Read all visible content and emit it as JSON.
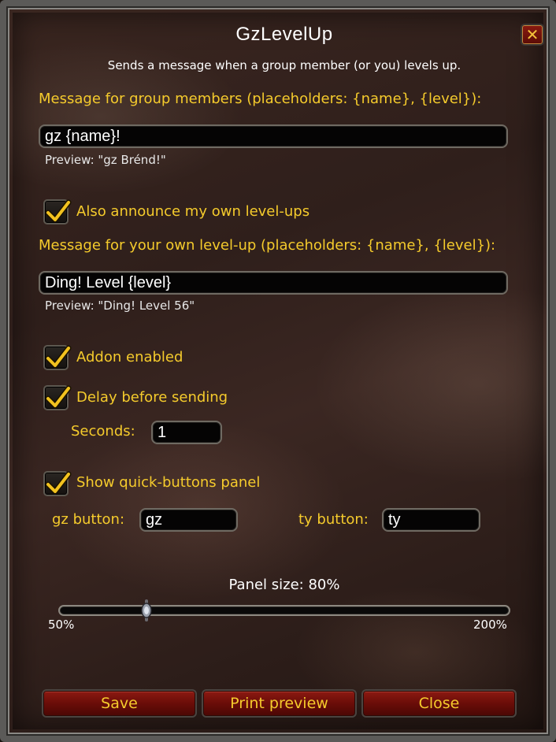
{
  "window": {
    "title": "GzLevelUp",
    "subtitle": "Sends a message when a group member (or you) levels up.",
    "close_symbol": "✕"
  },
  "group_message": {
    "label": "Message for group members (placeholders: {name}, {level}):",
    "value": "gz {name}!",
    "preview": "Preview: \"gz Brénd!\""
  },
  "own_announce": {
    "label": "Also announce my own level-ups",
    "checked": true
  },
  "own_message": {
    "label": "Message for your own level-up (placeholders: {name}, {level}):",
    "value": "Ding! Level {level}",
    "preview": "Preview: \"Ding! Level 56\""
  },
  "addon_enabled": {
    "label": "Addon enabled",
    "checked": true
  },
  "delay": {
    "label": "Delay before sending",
    "checked": true,
    "seconds_label": "Seconds:",
    "seconds_value": "1"
  },
  "quick_buttons": {
    "label": "Show quick-buttons panel",
    "checked": true,
    "gz_label": "gz button:",
    "gz_value": "gz",
    "ty_label": "ty button:",
    "ty_value": "ty"
  },
  "panel_size": {
    "label": "Panel size: 80%",
    "min_label": "50%",
    "max_label": "200%",
    "min": 50,
    "max": 200,
    "value": 80
  },
  "buttons": {
    "save": "Save",
    "print_preview": "Print preview",
    "close": "Close"
  },
  "colors": {
    "label_gold": "#f5cb2c",
    "button_red": "#7a1209",
    "background": "#2f1f1b"
  },
  "icons": {
    "close": "close-icon",
    "check": "checkmark-icon",
    "slider_thumb": "slider-thumb-icon"
  }
}
